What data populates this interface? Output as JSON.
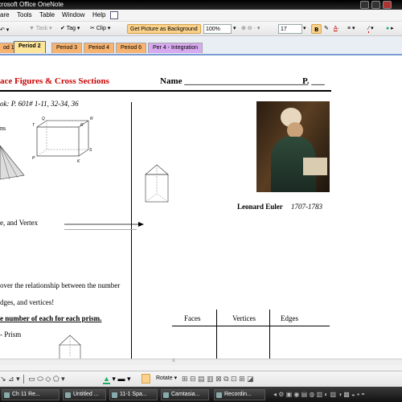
{
  "window": {
    "title": "icrosoft Office OneNote"
  },
  "menu": [
    "are",
    "Tools",
    "Table",
    "Window",
    "Help"
  ],
  "toolbar": {
    "task_label": "Task",
    "tag_label": "Tag",
    "clip_label": "Clip",
    "picture_bg_label": "Get Picture as Background",
    "zoom_value": "100%",
    "font_size_value": "17"
  },
  "tabs": [
    "od 1",
    "Period 2",
    "Period 3",
    "Period 4",
    "Period 6",
    "Per 4 - Integration"
  ],
  "document": {
    "title": "ace Figures & Cross Sections",
    "name_label": "Name ____________________________",
    "period_label": "P. ___",
    "assignment": "ok:  P. 601# 1-11, 32-34, 36",
    "ns_fragment": "ns",
    "vertex_text": "e, and Vertex",
    "relationship_text": "over the relationship between the number",
    "edges_text": "dges, and vertices!",
    "instruction": "e number of each for each prism.",
    "prism_text": "- Prism",
    "euler_name": "Leonard Euler",
    "euler_years": "1707-1783",
    "table_headers": [
      "Faces",
      "Vertices",
      "Edges"
    ],
    "cube_vertex_labels": [
      "Q",
      "R",
      "R",
      "T",
      "S",
      "P",
      "K"
    ]
  },
  "taskbar": [
    "Ch 11 Re...",
    "Untitled ...",
    "11-1 Spa...",
    "Camtasia...",
    "Recordin..."
  ],
  "draw": {
    "rotate_label": "Rotate"
  },
  "colors": {
    "title_red": "#cc0000",
    "tab_period2": "#fde59a",
    "tab_other": "#f7b36f",
    "tab_integration": "#d7a9ef",
    "bg_button": "#fbd28b"
  }
}
